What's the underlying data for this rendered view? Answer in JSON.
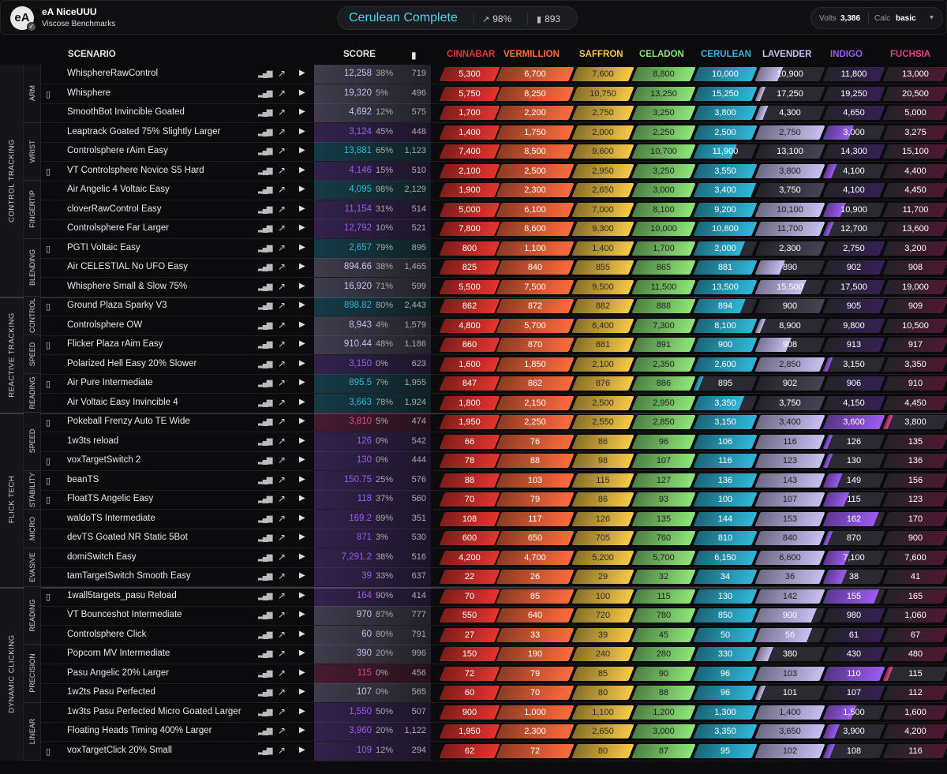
{
  "header": {
    "logo_text": "eA",
    "username": "eA NiceUUU",
    "subtitle": "Viscose Benchmarks",
    "rank_title": "Cerulean Complete",
    "progress_pct": "98%",
    "progress_count": "893",
    "volts_label": "Volts",
    "volts_value": "3,386",
    "calc_label": "Calc",
    "calc_value": "basic"
  },
  "columns": {
    "scenario": "SCENARIO",
    "score": "SCORE",
    "ranks": [
      {
        "name": "CINNABAR",
        "color": "#e3342f"
      },
      {
        "name": "VERMILLION",
        "color": "#ff6b3d"
      },
      {
        "name": "SAFFRON",
        "color": "#f7c948"
      },
      {
        "name": "CELADON",
        "color": "#8ee67a"
      },
      {
        "name": "CERULEAN",
        "color": "#2fb7d9"
      },
      {
        "name": "LAVENDER",
        "color": "#c7c0f2"
      },
      {
        "name": "INDIGO",
        "color": "#9b5cf0"
      },
      {
        "name": "FUCHSIA",
        "color": "#e0458e"
      }
    ]
  },
  "groups": [
    {
      "label": "CONTROL TRACKING",
      "start": 0,
      "end": 12
    },
    {
      "label": "REACTIVE TRACKING",
      "start": 12,
      "end": 18
    },
    {
      "label": "FLICK TECH",
      "start": 18,
      "end": 27
    },
    {
      "label": "DYNAMIC CLICKING",
      "start": 27,
      "end": 36
    }
  ],
  "subgroups": [
    {
      "label": "ARM",
      "start": 0,
      "end": 3
    },
    {
      "label": "WRIST",
      "start": 3,
      "end": 6
    },
    {
      "label": "FINGERTIP",
      "start": 6,
      "end": 9
    },
    {
      "label": "BLENDING",
      "start": 9,
      "end": 12
    },
    {
      "label": "CONTROL",
      "start": 12,
      "end": 14
    },
    {
      "label": "SPEED",
      "start": 14,
      "end": 16
    },
    {
      "label": "READING",
      "start": 16,
      "end": 18
    },
    {
      "label": "SPEED",
      "start": 18,
      "end": 21
    },
    {
      "label": "STABILITY",
      "start": 21,
      "end": 23
    },
    {
      "label": "MICRO",
      "start": 23,
      "end": 25
    },
    {
      "label": "EVASIVE",
      "start": 25,
      "end": 27
    },
    {
      "label": "READING",
      "start": 27,
      "end": 30
    },
    {
      "label": "PRECISION",
      "start": 30,
      "end": 33
    },
    {
      "label": "LINEAR",
      "start": 33,
      "end": 36
    }
  ],
  "rows": [
    {
      "name": "WhisphereRawControl",
      "book": false,
      "score": "12,258",
      "pct": "38%",
      "count": "719",
      "rank": 6,
      "fill": 0.35,
      "th": [
        "5,300",
        "6,700",
        "7,600",
        "8,800",
        "10,000",
        "10,900",
        "11,800",
        "13,000"
      ]
    },
    {
      "name": "Whisphere",
      "book": true,
      "score": "19,320",
      "pct": "5%",
      "count": "496",
      "rank": 6,
      "fill": 0.05,
      "th": [
        "5,750",
        "8,250",
        "10,750",
        "13,250",
        "15,250",
        "17,250",
        "19,250",
        "20,500"
      ]
    },
    {
      "name": "SmoothBot Invincible Goated",
      "book": false,
      "score": "4,692",
      "pct": "12%",
      "count": "575",
      "rank": 6,
      "fill": 0.12,
      "th": [
        "1,700",
        "2,200",
        "2,750",
        "3,250",
        "3,800",
        "4,300",
        "4,650",
        "5,000"
      ]
    },
    {
      "name": "Leaptrack Goated 75% Slightly Larger",
      "book": false,
      "score": "3,124",
      "pct": "45%",
      "count": "448",
      "rank": 7,
      "fill": 0.45,
      "th": [
        "1,400",
        "1,750",
        "2,000",
        "2,250",
        "2,500",
        "2,750",
        "3,000",
        "3,275"
      ]
    },
    {
      "name": "Controlsphere rAim Easy",
      "book": false,
      "score": "13,881",
      "pct": "65%",
      "count": "1,123",
      "rank": 5,
      "fill": 0.65,
      "th": [
        "7,400",
        "8,500",
        "9,600",
        "10,700",
        "11,900",
        "13,100",
        "14,300",
        "15,100"
      ]
    },
    {
      "name": "VT Controlsphere Novice S5 Hard",
      "book": true,
      "score": "4,146",
      "pct": "15%",
      "count": "510",
      "rank": 7,
      "fill": 0.15,
      "th": [
        "2,100",
        "2,500",
        "2,950",
        "3,250",
        "3,550",
        "3,800",
        "4,100",
        "4,400"
      ]
    },
    {
      "name": "Air Angelic 4 Voltaic Easy",
      "book": false,
      "score": "4,095",
      "pct": "98%",
      "count": "2,129",
      "rank": 5,
      "fill": 0.98,
      "th": [
        "1,900",
        "2,300",
        "2,650",
        "3,000",
        "3,400",
        "3,750",
        "4,100",
        "4,450"
      ]
    },
    {
      "name": "cloverRawControl Easy",
      "book": false,
      "score": "11,154",
      "pct": "31%",
      "count": "514",
      "rank": 7,
      "fill": 0.31,
      "th": [
        "5,000",
        "6,100",
        "7,000",
        "8,100",
        "9,200",
        "10,100",
        "10,900",
        "11,700"
      ]
    },
    {
      "name": "Controlsphere Far Larger",
      "book": false,
      "score": "12,792",
      "pct": "10%",
      "count": "521",
      "rank": 7,
      "fill": 0.1,
      "th": [
        "7,800",
        "8,600",
        "9,300",
        "10,000",
        "10,800",
        "11,700",
        "12,700",
        "13,600"
      ]
    },
    {
      "name": "PGTI Voltaic Easy",
      "book": true,
      "score": "2,657",
      "pct": "79%",
      "count": "895",
      "rank": 5,
      "fill": 0.79,
      "th": [
        "800",
        "1,100",
        "1,400",
        "1,700",
        "2,000",
        "2,300",
        "2,750",
        "3,200"
      ]
    },
    {
      "name": "Air CELESTIAL No UFO Easy",
      "book": false,
      "score": "894.66",
      "pct": "38%",
      "count": "1,465",
      "rank": 6,
      "fill": 0.38,
      "th": [
        "825",
        "840",
        "855",
        "865",
        "881",
        "890",
        "902",
        "908"
      ]
    },
    {
      "name": "Whisphere Small & Slow 75%",
      "book": false,
      "score": "16,920",
      "pct": "71%",
      "count": "599",
      "rank": 6,
      "fill": 0.71,
      "th": [
        "5,500",
        "7,500",
        "9,500",
        "11,500",
        "13,500",
        "15,500",
        "17,500",
        "19,000"
      ]
    },
    {
      "name": "Ground Plaza Sparky V3",
      "book": true,
      "score": "898.82",
      "pct": "80%",
      "count": "2,443",
      "rank": 5,
      "fill": 0.8,
      "th": [
        "862",
        "872",
        "882",
        "888",
        "894",
        "900",
        "905",
        "909"
      ]
    },
    {
      "name": "Controlsphere OW",
      "book": false,
      "score": "8,943",
      "pct": "4%",
      "count": "1,579",
      "rank": 6,
      "fill": 0.04,
      "th": [
        "4,800",
        "5,700",
        "6,400",
        "7,300",
        "8,100",
        "8,900",
        "9,800",
        "10,500"
      ]
    },
    {
      "name": "Flicker Plaza rAim Easy",
      "book": true,
      "score": "910.44",
      "pct": "48%",
      "count": "1,186",
      "rank": 6,
      "fill": 0.48,
      "th": [
        "860",
        "870",
        "881",
        "891",
        "900",
        "908",
        "913",
        "917"
      ]
    },
    {
      "name": "Polarized Hell Easy 20% Slower",
      "book": false,
      "score": "3,150",
      "pct": "0%",
      "count": "623",
      "rank": 7,
      "fill": 0.0,
      "th": [
        "1,600",
        "1,850",
        "2,100",
        "2,350",
        "2,600",
        "2,850",
        "3,150",
        "3,350"
      ]
    },
    {
      "name": "Air Pure Intermediate",
      "book": true,
      "score": "895.5",
      "pct": "7%",
      "count": "1,955",
      "rank": 5,
      "fill": 0.07,
      "th": [
        "847",
        "862",
        "876",
        "886",
        "895",
        "902",
        "906",
        "910"
      ]
    },
    {
      "name": "Air Voltaic Easy Invincible 4",
      "book": false,
      "score": "3,663",
      "pct": "78%",
      "count": "1,924",
      "rank": 5,
      "fill": 0.78,
      "th": [
        "1,800",
        "2,150",
        "2,500",
        "2,950",
        "3,350",
        "3,750",
        "4,150",
        "4,450"
      ]
    },
    {
      "name": "Pokeball Frenzy Auto TE Wide",
      "book": true,
      "score": "3,810",
      "pct": "5%",
      "count": "474",
      "rank": 8,
      "fill": 0.05,
      "th": [
        "1,950",
        "2,250",
        "2,550",
        "2,850",
        "3,150",
        "3,400",
        "3,600",
        "3,800"
      ]
    },
    {
      "name": "1w3ts reload",
      "book": false,
      "score": "126",
      "pct": "0%",
      "count": "542",
      "rank": 7,
      "fill": 0.0,
      "th": [
        "66",
        "76",
        "86",
        "96",
        "106",
        "116",
        "126",
        "135"
      ]
    },
    {
      "name": "voxTargetSwitch 2",
      "book": true,
      "score": "130",
      "pct": "0%",
      "count": "444",
      "rank": 7,
      "fill": 0.0,
      "th": [
        "78",
        "88",
        "98",
        "107",
        "116",
        "123",
        "130",
        "136"
      ]
    },
    {
      "name": "beanTS",
      "book": true,
      "score": "150.75",
      "pct": "25%",
      "count": "576",
      "rank": 7,
      "fill": 0.25,
      "th": [
        "88",
        "103",
        "115",
        "127",
        "136",
        "143",
        "149",
        "156"
      ]
    },
    {
      "name": "FloatTS Angelic Easy",
      "book": true,
      "score": "118",
      "pct": "37%",
      "count": "560",
      "rank": 7,
      "fill": 0.37,
      "th": [
        "70",
        "79",
        "86",
        "93",
        "100",
        "107",
        "115",
        "123"
      ]
    },
    {
      "name": "waldoTS Intermediate",
      "book": false,
      "score": "169.2",
      "pct": "89%",
      "count": "351",
      "rank": 7,
      "fill": 0.89,
      "th": [
        "108",
        "117",
        "126",
        "135",
        "144",
        "153",
        "162",
        "170"
      ]
    },
    {
      "name": "devTS Goated NR Static 5Bot",
      "book": false,
      "score": "871",
      "pct": "3%",
      "count": "530",
      "rank": 7,
      "fill": 0.03,
      "th": [
        "600",
        "650",
        "705",
        "760",
        "810",
        "840",
        "870",
        "900"
      ]
    },
    {
      "name": "domiSwitch Easy",
      "book": false,
      "score": "7,291.2",
      "pct": "38%",
      "count": "516",
      "rank": 7,
      "fill": 0.38,
      "th": [
        "4,200",
        "4,700",
        "5,200",
        "5,700",
        "6,150",
        "6,600",
        "7,100",
        "7,600"
      ]
    },
    {
      "name": "tamTargetSwitch Smooth Easy",
      "book": false,
      "score": "39",
      "pct": "33%",
      "count": "637",
      "rank": 7,
      "fill": 0.33,
      "th": [
        "22",
        "26",
        "29",
        "32",
        "34",
        "36",
        "38",
        "41"
      ]
    },
    {
      "name": "1wall5targets_pasu Reload",
      "book": true,
      "score": "164",
      "pct": "90%",
      "count": "414",
      "rank": 7,
      "fill": 0.9,
      "th": [
        "70",
        "85",
        "100",
        "115",
        "130",
        "142",
        "155",
        "165"
      ]
    },
    {
      "name": "VT Bounceshot Intermediate",
      "book": false,
      "score": "970",
      "pct": "87%",
      "count": "777",
      "rank": 6,
      "fill": 0.87,
      "th": [
        "550",
        "640",
        "720",
        "780",
        "850",
        "900",
        "980",
        "1,060"
      ]
    },
    {
      "name": "Controlsphere Click",
      "book": false,
      "score": "60",
      "pct": "80%",
      "count": "791",
      "rank": 6,
      "fill": 0.8,
      "th": [
        "27",
        "33",
        "39",
        "45",
        "50",
        "56",
        "61",
        "67"
      ]
    },
    {
      "name": "Popcorn MV Intermediate",
      "book": false,
      "score": "390",
      "pct": "20%",
      "count": "996",
      "rank": 6,
      "fill": 0.2,
      "th": [
        "150",
        "190",
        "240",
        "280",
        "330",
        "380",
        "430",
        "480"
      ]
    },
    {
      "name": "Pasu Angelic 20% Larger",
      "book": false,
      "score": "115",
      "pct": "0%",
      "count": "456",
      "rank": 8,
      "fill": 0.0,
      "th": [
        "72",
        "79",
        "85",
        "90",
        "96",
        "103",
        "110",
        "115"
      ]
    },
    {
      "name": "1w2ts Pasu Perfected",
      "book": false,
      "score": "107",
      "pct": "0%",
      "count": "565",
      "rank": 6,
      "fill": 0.0,
      "th": [
        "60",
        "70",
        "80",
        "88",
        "96",
        "101",
        "107",
        "112"
      ]
    },
    {
      "name": "1w3ts Pasu Perfected Micro Goated Larger",
      "book": false,
      "score": "1,550",
      "pct": "50%",
      "count": "507",
      "rank": 7,
      "fill": 0.5,
      "th": [
        "900",
        "1,000",
        "1,100",
        "1,200",
        "1,300",
        "1,400",
        "1,500",
        "1,600"
      ]
    },
    {
      "name": "Floating Heads Timing 400% Larger",
      "book": false,
      "score": "3,960",
      "pct": "20%",
      "count": "1,122",
      "rank": 7,
      "fill": 0.2,
      "th": [
        "1,950",
        "2,300",
        "2,650",
        "3,000",
        "3,350",
        "3,650",
        "3,900",
        "4,200"
      ]
    },
    {
      "name": "voxTargetClick 20% Small",
      "book": true,
      "score": "109",
      "pct": "12%",
      "count": "294",
      "rank": 7,
      "fill": 0.12,
      "th": [
        "62",
        "72",
        "80",
        "87",
        "95",
        "102",
        "108",
        "116"
      ]
    }
  ]
}
